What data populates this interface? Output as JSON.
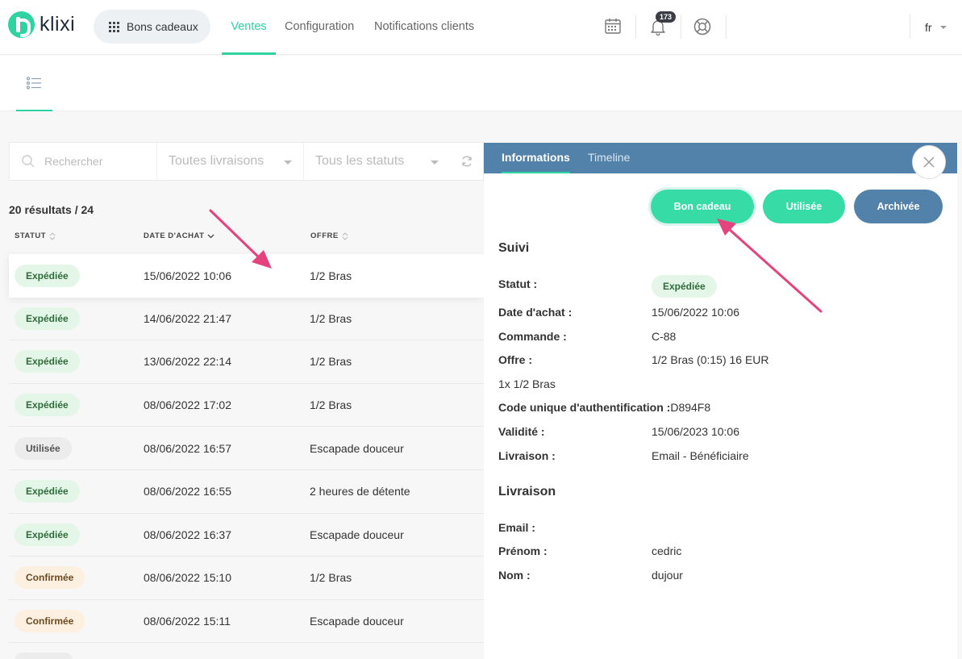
{
  "header": {
    "logo_text": "klixi",
    "app_switch_label": "Bons cadeaux",
    "nav": [
      {
        "label": "Ventes",
        "active": true
      },
      {
        "label": "Configuration",
        "active": false
      },
      {
        "label": "Notifications clients",
        "active": false
      }
    ],
    "notification_count": "173",
    "language": "fr"
  },
  "filters": {
    "search_placeholder": "Rechercher",
    "delivery_select": "Toutes livraisons",
    "status_select": "Tous les statuts"
  },
  "results_label": "20 résultats / 24",
  "table": {
    "columns": [
      "STATUT",
      "DATE D'ACHAT",
      "OFFRE"
    ],
    "rows": [
      {
        "status": "Expédiée",
        "tone": "green",
        "date": "15/06/2022 10:06",
        "offer": "1/2 Bras"
      },
      {
        "status": "Expédiée",
        "tone": "green",
        "date": "14/06/2022 21:47",
        "offer": "1/2 Bras"
      },
      {
        "status": "Expédiée",
        "tone": "green",
        "date": "13/06/2022 22:14",
        "offer": "1/2 Bras"
      },
      {
        "status": "Expédiée",
        "tone": "green",
        "date": "08/06/2022 17:02",
        "offer": "1/2 Bras"
      },
      {
        "status": "Utilisée",
        "tone": "grey",
        "date": "08/06/2022 16:57",
        "offer": "Escapade douceur"
      },
      {
        "status": "Expédiée",
        "tone": "green",
        "date": "08/06/2022 16:55",
        "offer": "2 heures de détente"
      },
      {
        "status": "Expédiée",
        "tone": "green",
        "date": "08/06/2022 16:37",
        "offer": "Escapade douceur"
      },
      {
        "status": "Confirmée",
        "tone": "orange",
        "date": "08/06/2022 15:10",
        "offer": "1/2 Bras"
      },
      {
        "status": "Confirmée",
        "tone": "orange",
        "date": "08/06/2022 15:11",
        "offer": "Escapade douceur"
      }
    ]
  },
  "detail": {
    "tabs": [
      {
        "label": "Informations",
        "active": true
      },
      {
        "label": "Timeline",
        "active": false
      }
    ],
    "actions": {
      "gift": "Bon cadeau",
      "used": "Utilisée",
      "archived": "Archivée"
    },
    "suivi": {
      "title": "Suivi",
      "status_label": "Statut :",
      "status_value": "Expédiée",
      "date_label": "Date d'achat :",
      "date_value": "15/06/2022 10:06",
      "order_label": "Commande :",
      "order_value": "C-88",
      "offer_label": "Offre :",
      "offer_value": "1/2 Bras (0:15) 16 EUR",
      "offer_line": "1x 1/2 Bras",
      "code_label": "Code unique d'authentification :",
      "code_value": "D894F8",
      "validity_label": "Validité :",
      "validity_value": "15/06/2023 10:06",
      "delivery_label": "Livraison :",
      "delivery_value": "Email - Bénéficiaire"
    },
    "livraison": {
      "title": "Livraison",
      "email_label": "Email :",
      "firstname_label": "Prénom :",
      "firstname_value": "cedric",
      "lastname_label": "Nom :",
      "lastname_value": "dujour"
    }
  },
  "colors": {
    "accent": "#2fd3a1",
    "header_blue": "#5282a9",
    "annotation": "#e5437e"
  }
}
